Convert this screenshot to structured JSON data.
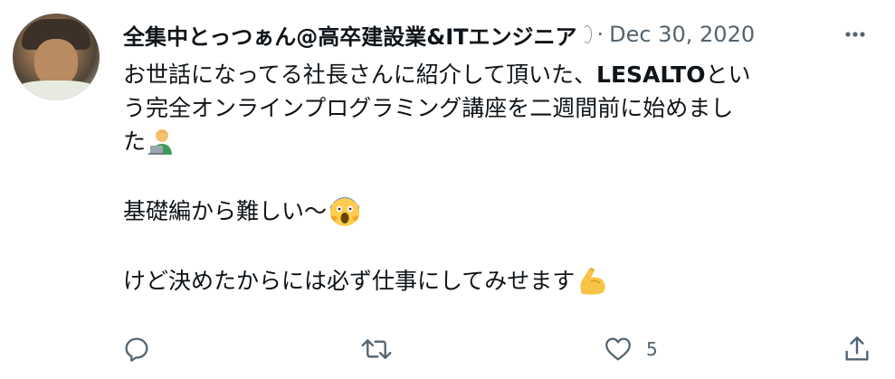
{
  "tweet": {
    "author_name": "全集中とっつぁん@高卒建設業&ITエンジニア",
    "separator": "·",
    "date": "Dec 30, 2020",
    "lines": {
      "l1a": "お世話になってる社長さんに紹介して頂いた、",
      "l1b": "LESALTO",
      "l1c": "とい",
      "l2": "う完全オンラインプログラミング講座を二週間前に始めまし",
      "l3": "た",
      "l4": "基礎編から難しい〜",
      "l5": "けど決めたからには必ず仕事にしてみせます"
    },
    "emojis": [
      "technologist-emoji",
      "screaming-face-emoji",
      "flexed-biceps-emoji"
    ]
  },
  "actions": {
    "like_count": "5",
    "icons": [
      "reply-icon",
      "retweet-icon",
      "like-icon",
      "share-icon"
    ]
  },
  "colors": {
    "text": "#0f1419",
    "secondary": "#536471"
  }
}
